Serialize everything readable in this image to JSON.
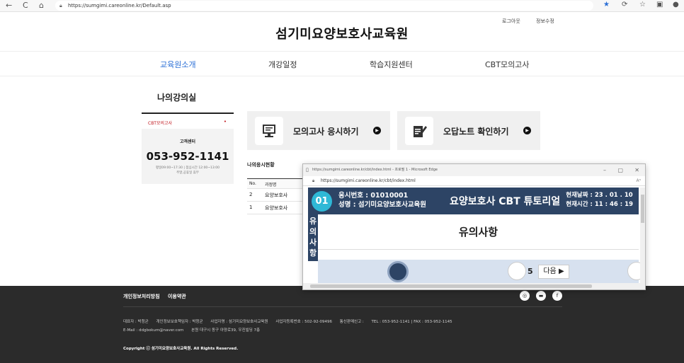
{
  "browser": {
    "url": "https://sumgimi.careonline.kr/Default.asp",
    "back": "←",
    "reload": "C",
    "home": "⌂"
  },
  "header": {
    "logout": "로그아웃",
    "edit_profile": "정보수정",
    "site_title": "섬기미요양보호사교육원"
  },
  "nav": [
    "교육원소개",
    "개강일정",
    "학습지원센터",
    "CBT모의고사"
  ],
  "nav_active_color": "#2b6fd6",
  "sidebar": {
    "page_title": "나의강의실",
    "active_item": "CBT모의고사",
    "active_dot": "•",
    "cs_title": "고객센터",
    "cs_phone": "053-952-1141",
    "cs_hours": "평일09:00~17:30 | 점심시간 12:00~13:00",
    "cs_holiday": "주말,공휴일 휴무"
  },
  "actions": [
    {
      "label": "모의고사 응시하기",
      "icon": "monitor-icon"
    },
    {
      "label": "오답노트 확인하기",
      "icon": "note-edit-icon"
    }
  ],
  "history": {
    "title": "나의응시현황",
    "headers": [
      "No.",
      "과정명"
    ],
    "rows": [
      {
        "no": "2",
        "course": "요양보호사"
      },
      {
        "no": "1",
        "course": "요양보호사"
      }
    ]
  },
  "popup": {
    "title_bar": "https://sumgimi.careonline.kr/cbt/index.html - 프로필 1 - Microsoft Edge",
    "address": "https://sumgimi.careonline.kr/cbt/index.html",
    "badge": "01",
    "exam_number": "응시번호 : 01010001",
    "name": "성명 : 섬기미요양보호사교육원",
    "title": "요양보호사 CBT 튜토리얼",
    "date": "현재날짜 : 23 . 01 . 10",
    "time": "현재시간 : 11 : 46 : 19",
    "side_label": "유의사항",
    "notice_title": "유의사항",
    "page_num": "5",
    "next_button": "다음 ▶",
    "header_color": "#2d4465",
    "badge_color": "#2fb8d6"
  },
  "footer": {
    "privacy": "개인정보처리방침",
    "terms": "이용약관",
    "sns": [
      "instagram-icon",
      "chat-icon",
      "facebook-icon"
    ],
    "sns_glyphs": [
      "◎",
      "▬",
      "f"
    ],
    "line1": [
      "대표자 : 박청균",
      "개인정보보호책임자 : 박청균",
      "사업자명 : 섬기미요양보호사교육원",
      "사업자등록번호 : 502-92-09496",
      "통신판매신고 :",
      "TEL : 053-952-1141  |  FAX : 053-952-1145"
    ],
    "line2": [
      "E-Mail : ddgbokum@naver.com",
      "본원 대구시 동구 아양로39, 우진빌딩 7층"
    ],
    "copyright": "Copyright ⓒ 섬기미요양보호사교육원. All Rights Reserved."
  }
}
